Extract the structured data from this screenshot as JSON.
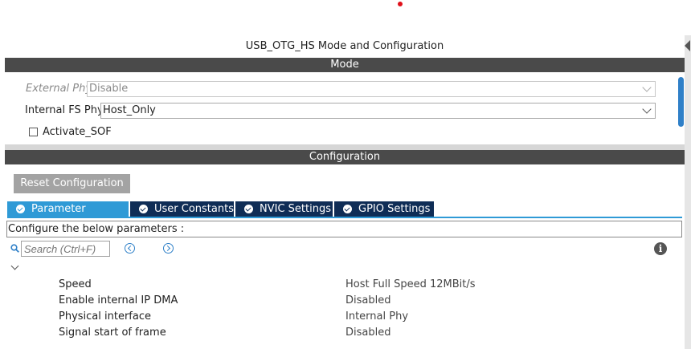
{
  "window": {
    "title": "USB_OTG_HS Mode and Configuration"
  },
  "mode": {
    "header": "Mode",
    "external_phy": {
      "label": "External Phy",
      "value": "Disable",
      "enabled": false
    },
    "internal_fs_phy": {
      "label": "Internal FS Phy",
      "value": "Host_Only",
      "enabled": true
    },
    "activate_sof": {
      "label": "Activate_SOF",
      "checked": false
    }
  },
  "configuration": {
    "header": "Configuration",
    "reset_label": "Reset Configuration",
    "tabs": [
      {
        "label": "Parameter Settings",
        "active": true
      },
      {
        "label": "User Constants",
        "active": false
      },
      {
        "label": "NVIC Settings",
        "active": false
      },
      {
        "label": "GPIO Settings",
        "active": false
      }
    ],
    "instructions": "Configure the below parameters :",
    "search": {
      "placeholder": "Search (Ctrl+F)"
    },
    "parameters": [
      {
        "name": "Speed",
        "value": "Host Full Speed 12MBit/s"
      },
      {
        "name": "Enable internal IP DMA",
        "value": "Disabled"
      },
      {
        "name": "Physical interface",
        "value": "Internal Phy"
      },
      {
        "name": "Signal start of frame",
        "value": "Disabled"
      }
    ]
  },
  "colors": {
    "header_bar": "#4a4a4a",
    "tab_active": "#2f9ad6",
    "tab_inactive": "#0f2d56",
    "reset_button": "#a3a3a3",
    "accent": "#2f80c8"
  },
  "icons": {
    "tab": "check-circle-icon",
    "search": "search-icon",
    "prev": "chevron-left-circle-icon",
    "next": "chevron-right-circle-icon",
    "info": "info-icon",
    "group": "chevron-down-icon"
  }
}
